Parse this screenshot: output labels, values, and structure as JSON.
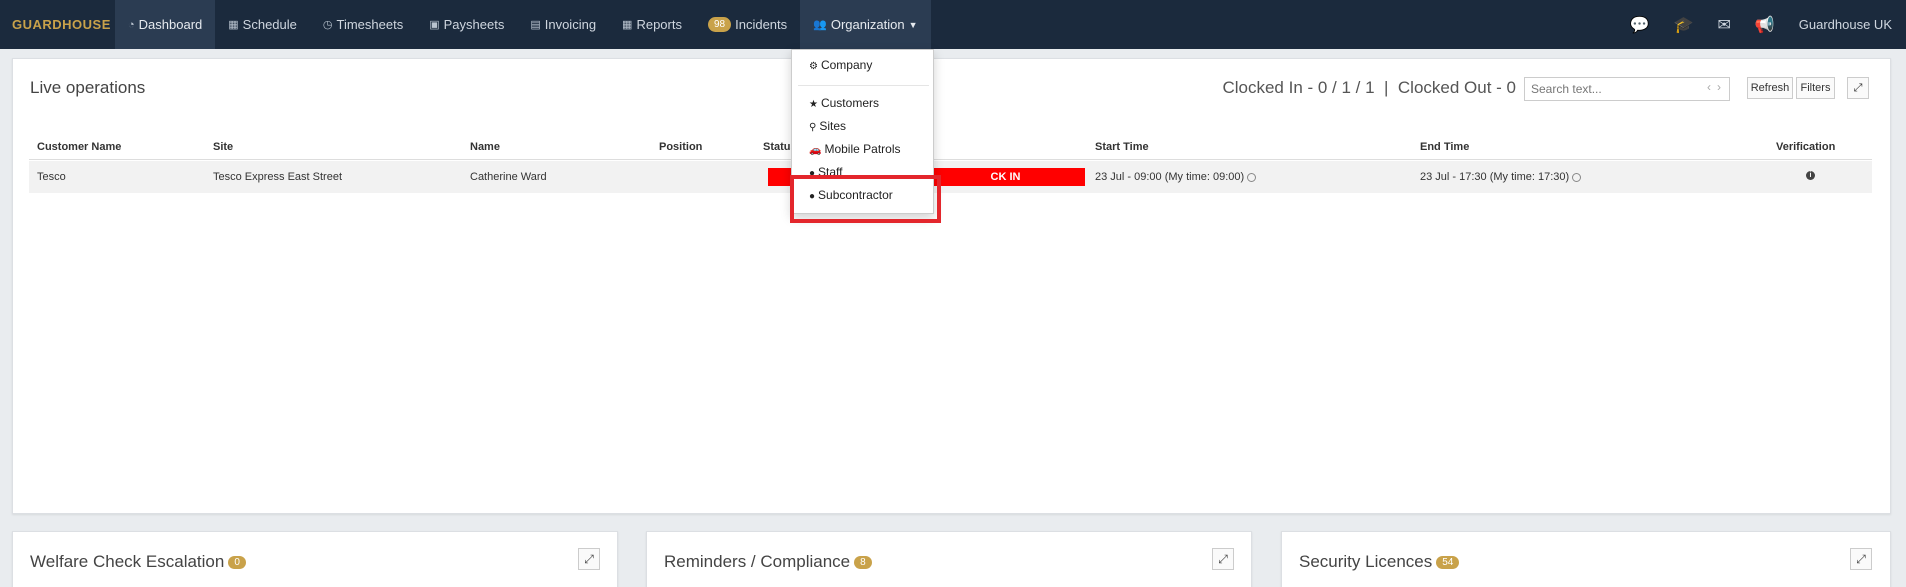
{
  "nav": {
    "brand": "GUARDHOUSE",
    "items": [
      {
        "label": "Dashboard",
        "icon": "dashboard-icon"
      },
      {
        "label": "Schedule",
        "icon": "calendar-icon"
      },
      {
        "label": "Timesheets",
        "icon": "clock-icon"
      },
      {
        "label": "Paysheets",
        "icon": "money-icon"
      },
      {
        "label": "Invoicing",
        "icon": "invoice-icon"
      },
      {
        "label": "Reports",
        "icon": "table-icon"
      },
      {
        "label": "Incidents",
        "badge": "98"
      },
      {
        "label": "Organization",
        "icon": "users-icon"
      }
    ],
    "user": "Guardhouse UK"
  },
  "org_menu": {
    "items": [
      "Company",
      "Customers",
      "Sites",
      "Mobile Patrols",
      "Staff",
      "Subcontractor"
    ]
  },
  "live": {
    "title": "Live operations",
    "clocked_summary": "Clocked In - 0 / 1 / 1  |  Clocked Out - 0",
    "search_placeholder": "Search text...",
    "refresh_label": "Refresh",
    "filters_label": "Filters",
    "columns": [
      "Customer Name",
      "Site",
      "Name",
      "Position",
      "Status",
      "Start Time",
      "End Time",
      "Verification"
    ],
    "row": {
      "customer": "Tesco",
      "site": "Tesco Express East Street",
      "name": "Catherine Ward",
      "position": "",
      "status_visible": "CK IN",
      "start": "23 Jul - 09:00 (My time: 09:00)",
      "end": "23 Jul - 17:30 (My time: 17:30)"
    }
  },
  "panels": {
    "welfare": {
      "title": "Welfare Check Escalation",
      "count": "0"
    },
    "reminders": {
      "title": "Reminders / Compliance",
      "count": "8"
    },
    "licences": {
      "title": "Security Licences",
      "count": "54"
    }
  },
  "colors": {
    "nav_bg": "#1b2a3d",
    "brand": "#c9a24a",
    "status_alert": "#ff0000",
    "highlight": "#e3262c"
  }
}
